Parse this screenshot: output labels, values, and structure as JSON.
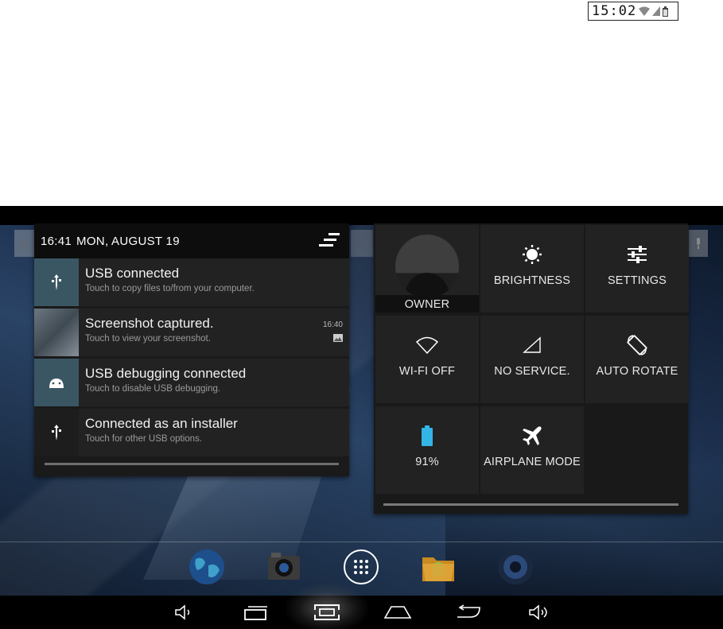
{
  "status_chip": {
    "time": "15:02"
  },
  "notifications": {
    "header_time": "16:41",
    "header_date": "MON, AUGUST 19",
    "items": [
      {
        "title": "USB connected",
        "subtitle": "Touch to copy files to/from your computer.",
        "icon": "usb-icon"
      },
      {
        "title": "Screenshot captured.",
        "subtitle": "Touch to view your screenshot.",
        "time": "16:40",
        "icon": "screenshot-thumbnail"
      },
      {
        "title": "USB debugging connected",
        "subtitle": "Touch to disable USB debugging.",
        "icon": "android-icon"
      },
      {
        "title": "Connected as an installer",
        "subtitle": "Touch for other USB options.",
        "icon": "usb-icon"
      }
    ]
  },
  "quick_settings": {
    "owner": "OWNER",
    "brightness": "BRIGHTNESS",
    "settings": "SETTINGS",
    "wifi": "WI-FI OFF",
    "service": "NO SERVICE.",
    "rotate": "AUTO ROTATE",
    "battery": "91%",
    "airplane": "AIRPLANE MODE"
  },
  "colors": {
    "battery_accent": "#33b5e5",
    "panel_bg": "#1a1a1a"
  }
}
